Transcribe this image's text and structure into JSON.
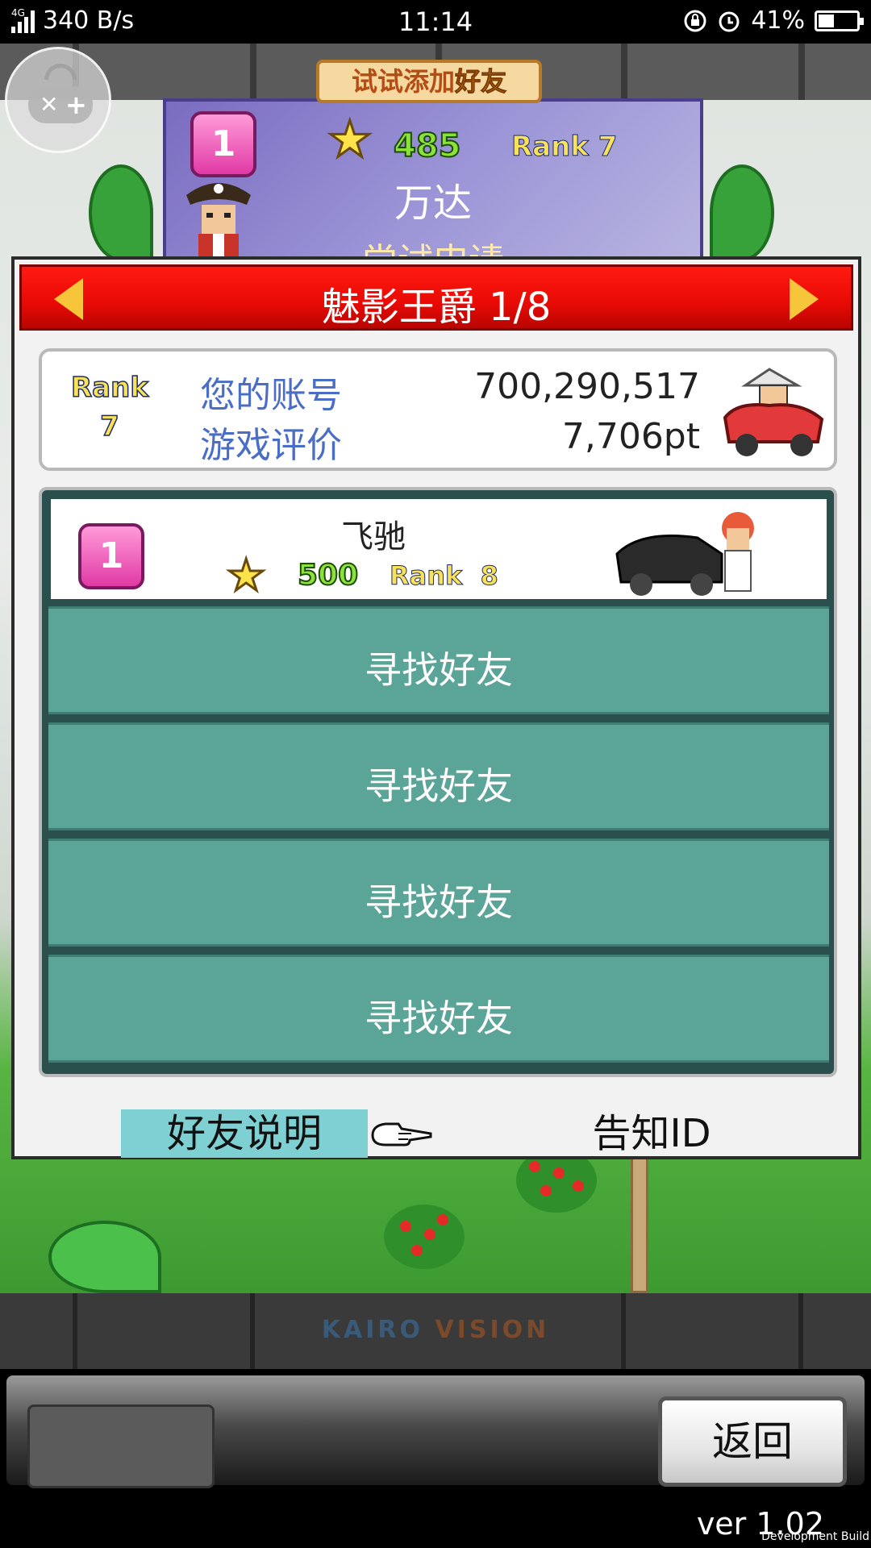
{
  "status_bar": {
    "network_type": "4G",
    "speed": "340 B/s",
    "time": "11:14",
    "battery_percent": "41%",
    "battery_level": 0.41,
    "icons": [
      "signal-icon",
      "lock-rotation-icon",
      "alarm-icon",
      "battery-icon"
    ]
  },
  "overlay": {
    "controller_icon": "gamepad-icon"
  },
  "banner": {
    "tag_prefix": "试试添加",
    "tag_highlight": "好友",
    "level": "1",
    "score": "485",
    "rank_label": "Rank",
    "rank_value": "7",
    "name": "万达",
    "subtitle": "尝试申请"
  },
  "panel": {
    "title": "魅影王爵 1/8",
    "account": {
      "rank_label": "Rank",
      "rank_value": "7",
      "account_label": "您的账号",
      "account_value": "700,290,517",
      "rating_label": "游戏评价",
      "rating_value": "7,706pt"
    },
    "friend": {
      "level": "1",
      "name": "飞驰",
      "score": "500",
      "rank_label": "Rank",
      "rank_value": "8"
    },
    "slots": [
      "寻找好友",
      "寻找好友",
      "寻找好友",
      "寻找好友"
    ],
    "help_button": "好友说明",
    "id_button": "告知ID"
  },
  "footer": {
    "brand_prefix": "KAIRO",
    "brand_suffix": "VISION",
    "back_button": "返回",
    "version": "ver 1.02",
    "build_note": "Development Build"
  },
  "colors": {
    "header_red": "#e80a05",
    "slot_teal": "#5aa597",
    "help_cyan": "#7fd0d3",
    "label_blue": "#4a6dc6"
  }
}
